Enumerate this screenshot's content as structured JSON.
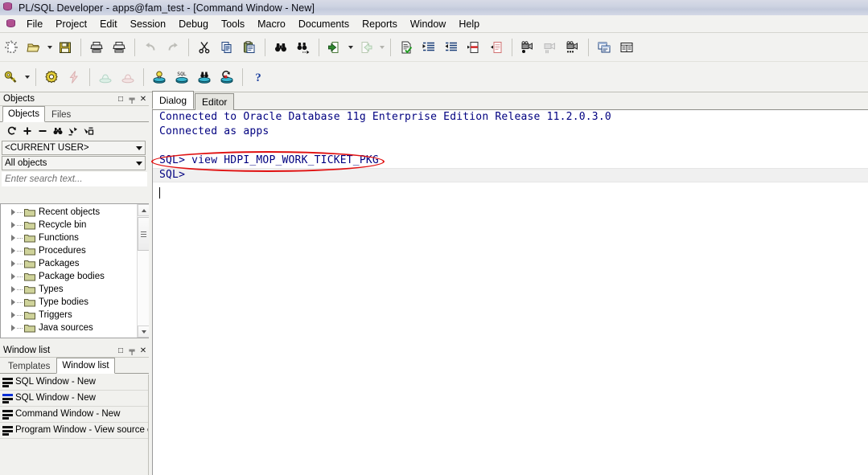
{
  "window": {
    "title": "PL/SQL Developer - apps@fam_test - [Command Window - New]",
    "app_icon": "database-icon"
  },
  "menubar": {
    "app_icon": "database-icon",
    "items": [
      {
        "label": "File"
      },
      {
        "label": "Project"
      },
      {
        "label": "Edit"
      },
      {
        "label": "Session"
      },
      {
        "label": "Debug"
      },
      {
        "label": "Tools"
      },
      {
        "label": "Macro"
      },
      {
        "label": "Documents"
      },
      {
        "label": "Reports"
      },
      {
        "label": "Window"
      },
      {
        "label": "Help"
      }
    ]
  },
  "toolbar_main": {
    "buttons": [
      {
        "name": "new-icon",
        "tip": "New"
      },
      {
        "name": "open-folder-icon",
        "tip": "Open"
      },
      {
        "name": "open-dropdown-arrow",
        "tip": "Open recent"
      },
      {
        "name": "save-floppy-icon",
        "tip": "Save"
      },
      {
        "name": "print-icon",
        "tip": "Print"
      },
      {
        "name": "print-preview-icon",
        "tip": "Print preview"
      },
      {
        "name": "undo-icon",
        "tip": "Undo"
      },
      {
        "name": "redo-icon",
        "tip": "Redo"
      },
      {
        "name": "cut-scissors-icon",
        "tip": "Cut"
      },
      {
        "name": "copy-icon",
        "tip": "Copy"
      },
      {
        "name": "paste-clipboard-icon",
        "tip": "Paste"
      },
      {
        "name": "find-binoculars-icon",
        "tip": "Find"
      },
      {
        "name": "find-next-icon",
        "tip": "Find next"
      },
      {
        "name": "import-icon",
        "tip": "Previous"
      },
      {
        "name": "import-dropdown-arrow",
        "tip": "Previous list"
      },
      {
        "name": "export-icon",
        "tip": "Next"
      },
      {
        "name": "export-dropdown-arrow",
        "tip": "Next list"
      },
      {
        "name": "check-document-icon",
        "tip": "Test"
      },
      {
        "name": "indent-icon",
        "tip": "Indent"
      },
      {
        "name": "outdent-icon",
        "tip": "Outdent"
      },
      {
        "name": "comment-icon",
        "tip": "Comment"
      },
      {
        "name": "uncomment-icon",
        "tip": "Uncomment"
      },
      {
        "name": "record-macro-icon",
        "tip": "Record macro"
      },
      {
        "name": "stop-macro-icon",
        "tip": "Stop macro"
      },
      {
        "name": "play-macro-icon",
        "tip": "Play macro"
      },
      {
        "name": "cascade-windows-icon",
        "tip": "Cascade"
      },
      {
        "name": "tile-windows-icon",
        "tip": "Tile"
      }
    ]
  },
  "toolbar_session": {
    "buttons": [
      {
        "name": "execute-key-icon",
        "tip": "Execute"
      },
      {
        "name": "execute-dropdown-arrow",
        "tip": "Execute options"
      },
      {
        "name": "break-gear-icon",
        "tip": "Break"
      },
      {
        "name": "kill-lightning-icon",
        "tip": "Kill"
      },
      {
        "name": "commit-icon",
        "tip": "Commit"
      },
      {
        "name": "rollback-icon",
        "tip": "Rollback"
      },
      {
        "name": "explain-plan-icon",
        "tip": "Explain plan"
      },
      {
        "name": "sql-icon",
        "tip": "SQL"
      },
      {
        "name": "session-find-icon",
        "tip": "Find database object"
      },
      {
        "name": "recompile-icon",
        "tip": "Recompile invalid objects"
      },
      {
        "name": "help-question-icon",
        "tip": "Help"
      }
    ]
  },
  "objects_panel": {
    "caption": "Objects",
    "caption_buttons": [
      {
        "name": "maximize-icon",
        "glyph": "□"
      },
      {
        "name": "pin-icon",
        "glyph": "╤"
      },
      {
        "name": "close-icon",
        "glyph": "✕"
      }
    ],
    "tabs": [
      {
        "label": "Objects",
        "active": true
      },
      {
        "label": "Files",
        "active": false
      }
    ],
    "toolbar": [
      {
        "name": "refresh-icon"
      },
      {
        "name": "expand-plus-icon"
      },
      {
        "name": "collapse-minus-icon"
      },
      {
        "name": "find-binoculars-icon"
      },
      {
        "name": "filter-icon"
      },
      {
        "name": "organize-icon"
      }
    ],
    "user_combo": {
      "value": "<CURRENT USER>",
      "name": "user-select"
    },
    "type_combo": {
      "value": "All objects",
      "name": "object-type-select"
    },
    "search": {
      "placeholder": "Enter search text...",
      "value": ""
    },
    "tree": [
      {
        "label": "Recent objects"
      },
      {
        "label": "Recycle bin"
      },
      {
        "label": "Functions"
      },
      {
        "label": "Procedures"
      },
      {
        "label": "Packages"
      },
      {
        "label": "Package bodies"
      },
      {
        "label": "Types"
      },
      {
        "label": "Type bodies"
      },
      {
        "label": "Triggers"
      },
      {
        "label": "Java sources"
      }
    ]
  },
  "window_list_panel": {
    "caption": "Window list",
    "caption_buttons": [
      {
        "name": "maximize-icon",
        "glyph": "□"
      },
      {
        "name": "pin-icon",
        "glyph": "╤"
      },
      {
        "name": "close-icon",
        "glyph": "✕"
      }
    ],
    "tabs": [
      {
        "label": "Templates",
        "active": false
      },
      {
        "label": "Window list",
        "active": true
      }
    ],
    "items": [
      {
        "label": "SQL Window - New",
        "active": false
      },
      {
        "label": "SQL Window - New",
        "active": true
      },
      {
        "label": "Command Window - New",
        "active": false
      },
      {
        "label": "Program Window - View source of",
        "active": false
      }
    ]
  },
  "main_area": {
    "tabs": [
      {
        "label": "Dialog",
        "active": true
      },
      {
        "label": "Editor",
        "active": false
      }
    ],
    "console_lines": [
      {
        "text": "Connected to Oracle Database 11g Enterprise Edition Release 11.2.0.3.0",
        "state": "normal"
      },
      {
        "text": "Connected as apps",
        "state": "normal"
      },
      {
        "text": "",
        "state": "normal"
      },
      {
        "text": "SQL> view HDPI_MOP_WORK_TICKET_PKG",
        "state": "normal"
      },
      {
        "text": "SQL>",
        "state": "current"
      }
    ]
  },
  "annotation": {
    "shape": "ellipse",
    "color": "#e01010",
    "targets_line": "SQL> view HDPI_MOP_WORK_TICKET_PKG"
  },
  "colors": {
    "console_text": "#000080",
    "annotation_red": "#e01010",
    "panel_bg": "#f1f1ee",
    "active_window_bar": "#0a2fd6",
    "folder_fill": "#cfd39a"
  }
}
